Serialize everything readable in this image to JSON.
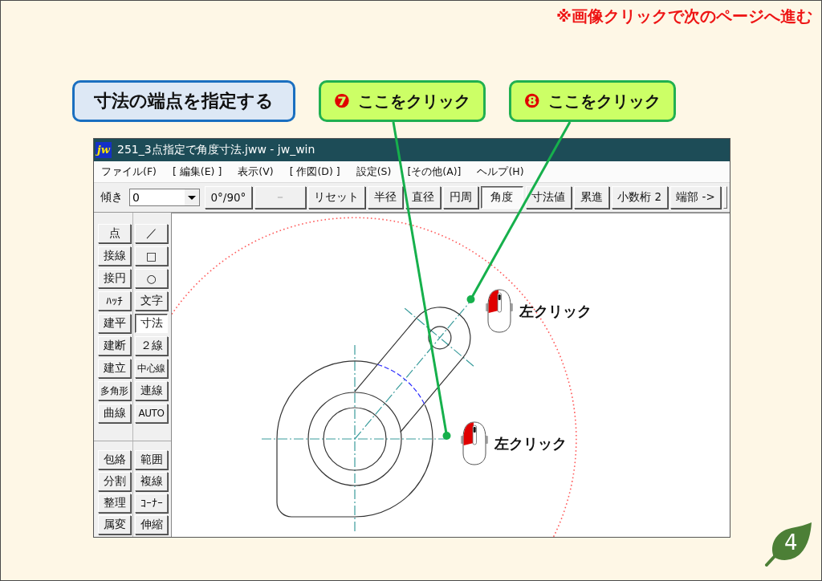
{
  "notice": "※画像クリックで次のページへ進む",
  "callouts": [
    {
      "kind": "heading",
      "text": "寸法の端点を指定する"
    },
    {
      "kind": "step",
      "number": "❼",
      "text": "ここをクリック"
    },
    {
      "kind": "step",
      "number": "❽",
      "text": "ここをクリック"
    }
  ],
  "window": {
    "app_icon": "jw",
    "title": "251_3点指定で角度寸法.jww - jw_win"
  },
  "menu": [
    "ファイル(F)",
    "[ 編集(E) ]",
    "表示(V)",
    "[ 作図(D) ]",
    "設定(S)",
    "[その他(A)]",
    "ヘルプ(H)"
  ],
  "toolbar": {
    "label": "傾き",
    "angle": "0",
    "buttons": [
      {
        "label": "0°/90°",
        "selected": false,
        "disabled": false
      },
      {
        "label": "－",
        "selected": false,
        "disabled": true
      },
      {
        "label": "リセット",
        "selected": false,
        "disabled": false
      },
      {
        "label": "半径",
        "selected": false,
        "disabled": false
      },
      {
        "label": "直径",
        "selected": false,
        "disabled": false
      },
      {
        "label": "円周",
        "selected": false,
        "disabled": false
      },
      {
        "label": "角度",
        "selected": true,
        "disabled": false
      },
      {
        "label": "寸法値",
        "selected": false,
        "disabled": false
      },
      {
        "label": "累進",
        "selected": false,
        "disabled": false
      },
      {
        "label": "小数桁 2",
        "selected": false,
        "disabled": false
      },
      {
        "label": "端部 ->",
        "selected": false,
        "disabled": false
      }
    ]
  },
  "palette": {
    "sections": [
      {
        "buttons": [
          {
            "label": "点",
            "selected": false
          },
          {
            "label": "／",
            "selected": false
          },
          {
            "label": "接線",
            "selected": false
          },
          {
            "label": "□",
            "selected": false
          },
          {
            "label": "接円",
            "selected": false
          },
          {
            "label": "○",
            "selected": false
          },
          {
            "label": "ﾊｯﾁ",
            "selected": false
          },
          {
            "label": "文字",
            "selected": false
          },
          {
            "label": "建平",
            "selected": false
          },
          {
            "label": "寸法",
            "selected": true
          },
          {
            "label": "建断",
            "selected": false
          },
          {
            "label": "２線",
            "selected": false
          },
          {
            "label": "建立",
            "selected": false
          },
          {
            "label": "中心線",
            "selected": false
          },
          {
            "label": "多角形",
            "selected": false
          },
          {
            "label": "連線",
            "selected": false
          },
          {
            "label": "曲線",
            "selected": false
          },
          {
            "label": "AUTO",
            "selected": false
          }
        ]
      },
      {
        "buttons": [
          {
            "label": "包絡",
            "selected": false
          },
          {
            "label": "範囲",
            "selected": false
          },
          {
            "label": "分割",
            "selected": false
          },
          {
            "label": "複線",
            "selected": false
          },
          {
            "label": "整理",
            "selected": false
          },
          {
            "label": "ｺｰﾅｰ",
            "selected": false
          },
          {
            "label": "属変",
            "selected": false
          },
          {
            "label": "伸縮",
            "selected": false
          }
        ]
      }
    ]
  },
  "canvas": {
    "clicks": [
      {
        "text": "左クリック"
      },
      {
        "text": "左クリック"
      }
    ]
  },
  "page_number": "4"
}
